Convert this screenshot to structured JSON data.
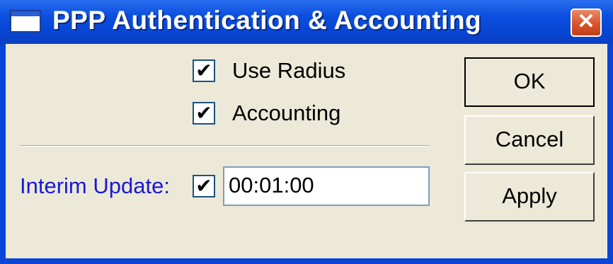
{
  "window": {
    "title": "PPP Authentication & Accounting",
    "close_glyph": "✕",
    "icon": "window-icon"
  },
  "options": {
    "use_radius": {
      "label": "Use Radius",
      "checked": true
    },
    "accounting": {
      "label": "Accounting",
      "checked": true
    }
  },
  "interim_update": {
    "label": "Interim Update:",
    "enabled": true,
    "value": "00:01:00"
  },
  "buttons": {
    "ok": "OK",
    "cancel": "Cancel",
    "apply": "Apply"
  },
  "check_glyph": "✔",
  "colors": {
    "titlebar": "#0b4fe0",
    "client_bg": "#ece9d8",
    "interim_label": "#1a1ad2",
    "close_button": "#d9532a"
  }
}
